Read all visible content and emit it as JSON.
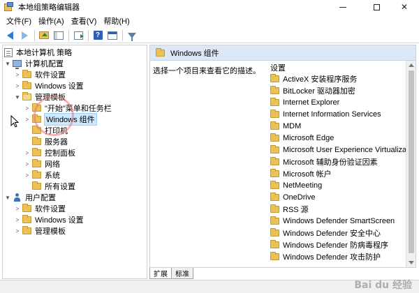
{
  "window": {
    "title": "本地组策略编辑器",
    "min_label": "",
    "close_label": "✕"
  },
  "menu": [
    "文件(F)",
    "操作(A)",
    "查看(V)",
    "帮助(H)"
  ],
  "tree": {
    "root": "本地计算机 策略",
    "computer": "计算机配置",
    "computer_children": [
      "软件设置",
      "Windows 设置",
      "管理模板"
    ],
    "admin_templates_children": [
      "\"开始\"菜单和任务栏",
      "Windows 组件",
      "打印机",
      "服务器",
      "控制面板",
      "网络",
      "系统",
      "所有设置"
    ],
    "user": "用户配置",
    "user_children": [
      "软件设置",
      "Windows 设置",
      "管理模板"
    ]
  },
  "details": {
    "header_title": "Windows 组件",
    "description": "选择一个项目来查看它的描述。",
    "column_header": "设置",
    "items": [
      "ActiveX 安装程序服务",
      "BitLocker 驱动器加密",
      "Internet Explorer",
      "Internet Information Services",
      "MDM",
      "Microsoft Edge",
      "Microsoft User Experience Virtualization",
      "Microsoft 辅助身份验证因素",
      "Microsoft 帐户",
      "NetMeeting",
      "OneDrive",
      "RSS 源",
      "Windows Defender SmartScreen",
      "Windows Defender 安全中心",
      "Windows Defender 防病毒程序",
      "Windows Defender 攻击防护"
    ]
  },
  "tabs": [
    "扩展",
    "标准"
  ],
  "watermark": "Bai du 经验"
}
